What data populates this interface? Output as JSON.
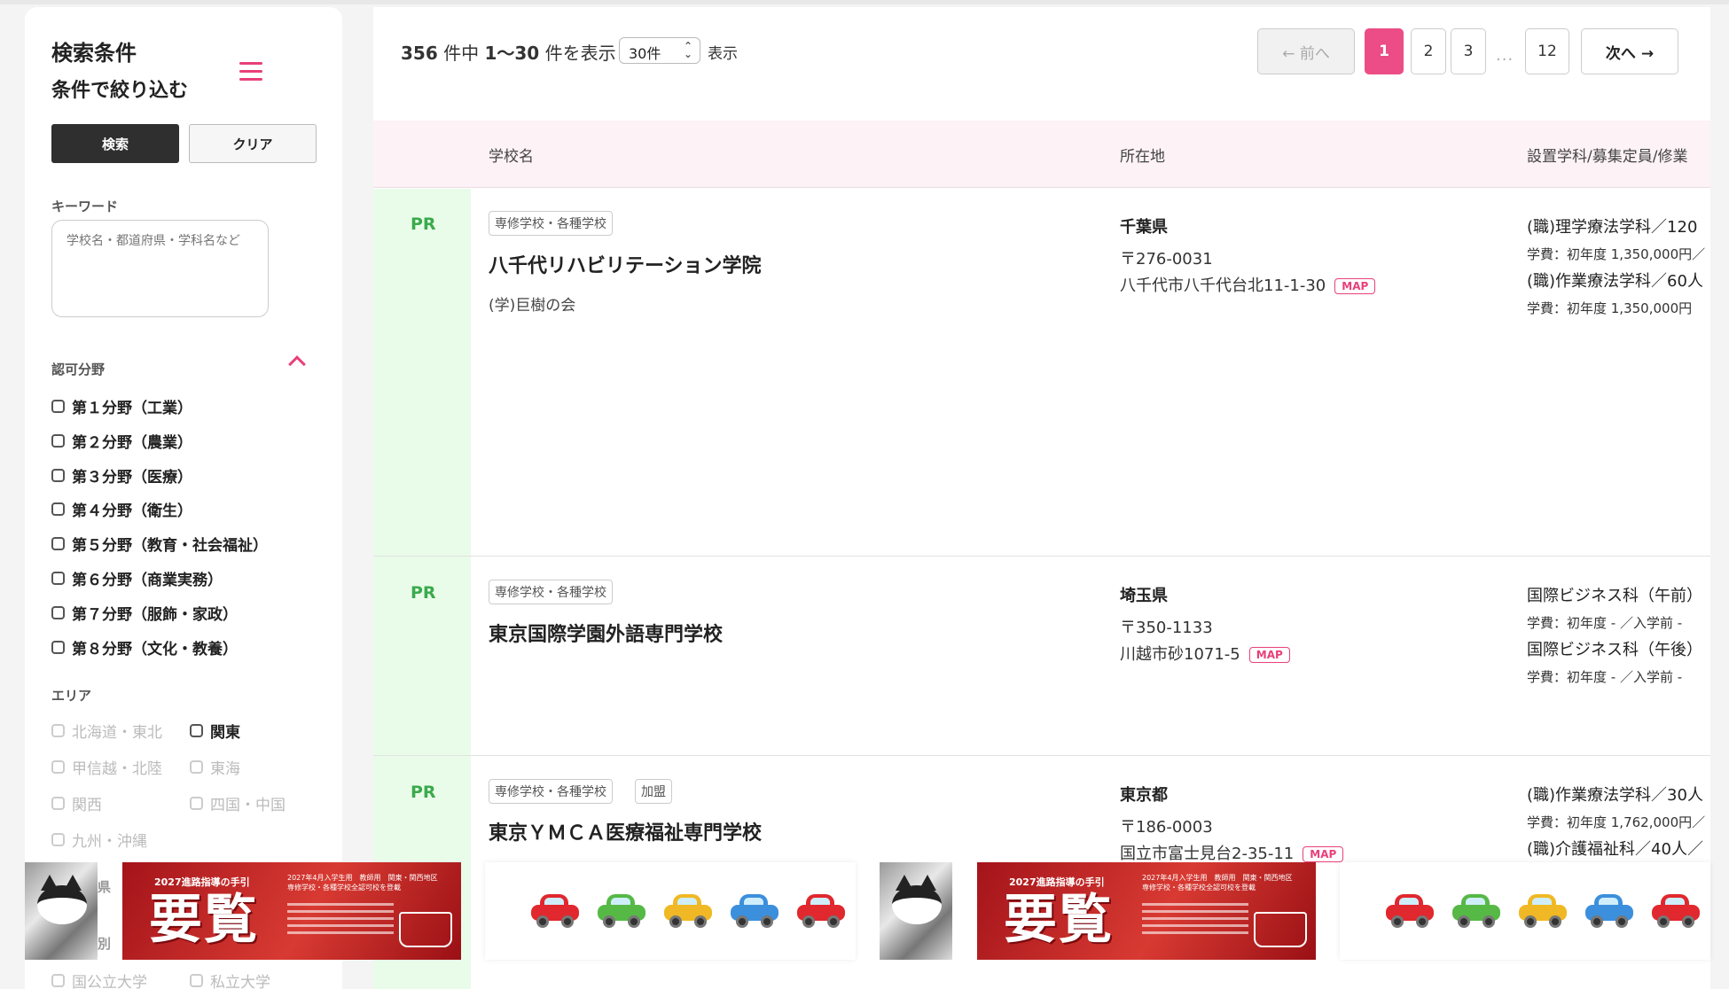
{
  "sidebar": {
    "title": "検索条件",
    "subtitle": "条件で絞り込む",
    "search_label": "検索",
    "clear_label": "クリア",
    "keyword_label": "キーワード",
    "keyword_placeholder": "学校名・都道府県・学科名など",
    "field_label": "認可分野",
    "fields": [
      "第１分野（工業）",
      "第２分野（農業）",
      "第３分野（医療）",
      "第４分野（衛生）",
      "第５分野（教育・社会福祉）",
      "第６分野（商業実務）",
      "第７分野（服飾・家政）",
      "第８分野（文化・教養）"
    ],
    "area_label": "エリア",
    "areas": [
      "北海道・東北",
      "関東",
      "甲信越・北陸",
      "東海",
      "関西",
      "四国・中国",
      "九州・沖縄"
    ],
    "partial_1": "県",
    "partial_2": "別",
    "school_types": [
      "国公立大学",
      "私立大学"
    ]
  },
  "results": {
    "total": "356",
    "range": "1〜30",
    "mid_text": "件中",
    "suffix": "件を表示",
    "per_page": "30件",
    "per_page_suffix": "表示"
  },
  "pagination": {
    "prev": "← 前へ",
    "pages": [
      "1",
      "2",
      "3"
    ],
    "dots": "...",
    "last": "12",
    "next": "次へ →"
  },
  "table": {
    "headers": [
      "学校名",
      "所在地",
      "設置学科/募集定員/修業"
    ]
  },
  "rows": [
    {
      "pr": "PR",
      "tags": [
        "専修学校・各種学校"
      ],
      "name": "八千代リハビリテーション学院",
      "corp": "(学)巨樹の会",
      "pref": "千葉県",
      "zip": "〒276-0031",
      "addr": "八千代市八千代台北11-1-30",
      "map": "MAP",
      "courses": [
        "(職)理学療法学科／120",
        "(職)作業療法学科／60人"
      ],
      "fees": [
        "学費：初年度 1,350,000円／",
        "学費：初年度 1,350,000円"
      ]
    },
    {
      "pr": "PR",
      "tags": [
        "専修学校・各種学校"
      ],
      "name": "東京国際学園外語専門学校",
      "corp": "",
      "pref": "埼玉県",
      "zip": "〒350-1133",
      "addr": "川越市砂1071-5",
      "map": "MAP",
      "courses": [
        "国際ビジネス科（午前）",
        "国際ビジネス科（午後）"
      ],
      "fees": [
        "学費：初年度 - ／入学前 -",
        "学費：初年度 - ／入学前 -"
      ]
    },
    {
      "pr": "PR",
      "tags": [
        "専修学校・各種学校",
        "加盟"
      ],
      "name": "東京ＹＭＣＡ医療福祉専門学校",
      "corp": "",
      "pref": "東京都",
      "zip": "〒186-0003",
      "addr": "国立市富士見台2-35-11",
      "map": "MAP",
      "courses": [
        "(職)作業療法学科／30人",
        "(職)介護福祉科／40人／"
      ],
      "fees": [
        "学費：初年度 1,762,000円／"
      ]
    }
  ],
  "ads": {
    "banner_top": "2027進路指導の手引",
    "banner_big": "要覧",
    "banner_sub": "2027年4月入学生用　教師用　関東・関西地区専修学校・各種学校全認可校を登載",
    "car_colors": [
      "#e0282e",
      "#56b946",
      "#f0b824",
      "#3c8fdc",
      "#e0282e"
    ]
  },
  "colors": {
    "accent": "#ec4d86",
    "pr_green": "#3aaa4c",
    "pr_bg": "#e9fce9",
    "header_bg": "#fdf2f6"
  }
}
